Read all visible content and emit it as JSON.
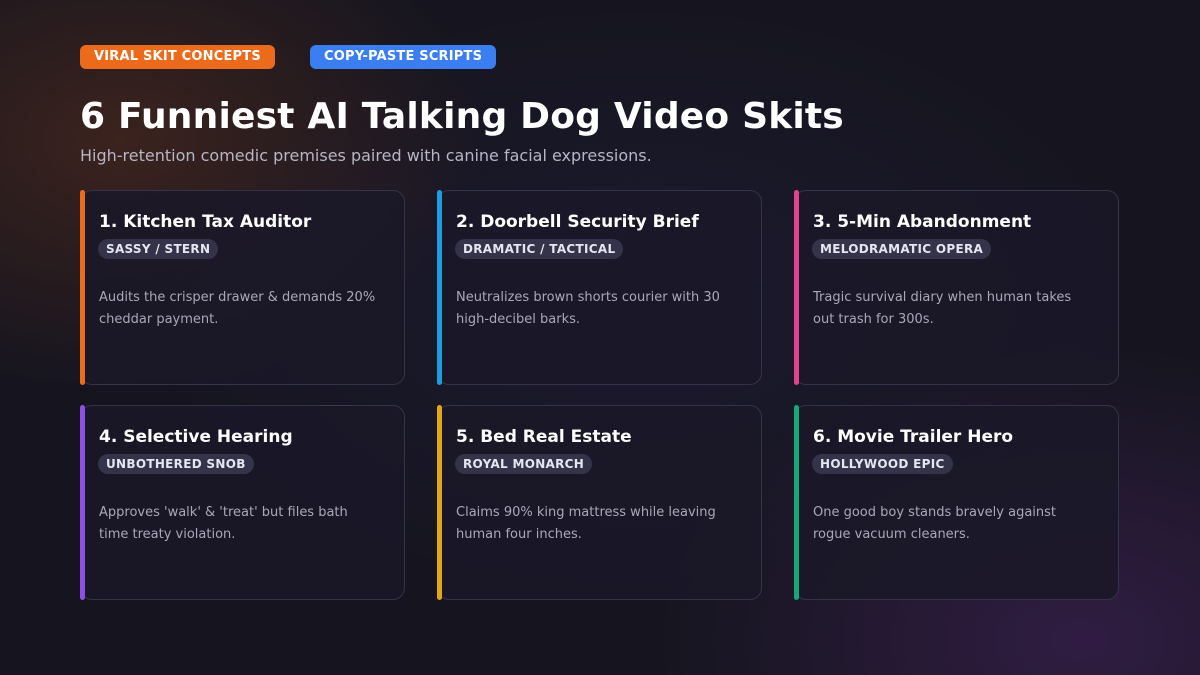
{
  "tags": [
    "VIRAL SKIT CONCEPTS",
    "COPY-PASTE SCRIPTS"
  ],
  "title": "6 Funniest AI Talking Dog Video Skits",
  "subtitle": "High-retention comedic premises paired with canine facial expressions.",
  "accent_colors": {
    "orange": "#ec6a1c",
    "blue": "#3b7ef2",
    "sky": "#1e9ce0",
    "pink": "#e0448f",
    "purple": "#8d4fe6",
    "gold": "#e3a810",
    "green": "#17a878"
  },
  "cards": [
    {
      "title": "1. Kitchen Tax Auditor",
      "badge": "SASSY / STERN",
      "description": "Audits the crisper drawer & demands 20% cheddar payment.",
      "accent": "#ec6a1c"
    },
    {
      "title": "2. Doorbell Security Brief",
      "badge": "DRAMATIC / TACTICAL",
      "description": "Neutralizes brown shorts courier with 30 high-decibel barks.",
      "accent": "#1e9ce0"
    },
    {
      "title": "3. 5-Min Abandonment",
      "badge": "MELODRAMATIC OPERA",
      "description": "Tragic survival diary when human takes out trash for 300s.",
      "accent": "#e0448f"
    },
    {
      "title": "4. Selective Hearing",
      "badge": "UNBOTHERED SNOB",
      "description": "Approves 'walk' & 'treat' but files bath time treaty violation.",
      "accent": "#8d4fe6"
    },
    {
      "title": "5. Bed Real Estate",
      "badge": "ROYAL MONARCH",
      "description": "Claims 90% king mattress while leaving human four inches.",
      "accent": "#e3a810"
    },
    {
      "title": "6. Movie Trailer Hero",
      "badge": "HOLLYWOOD EPIC",
      "description": "One good boy stands bravely against rogue vacuum cleaners.",
      "accent": "#17a878"
    }
  ]
}
